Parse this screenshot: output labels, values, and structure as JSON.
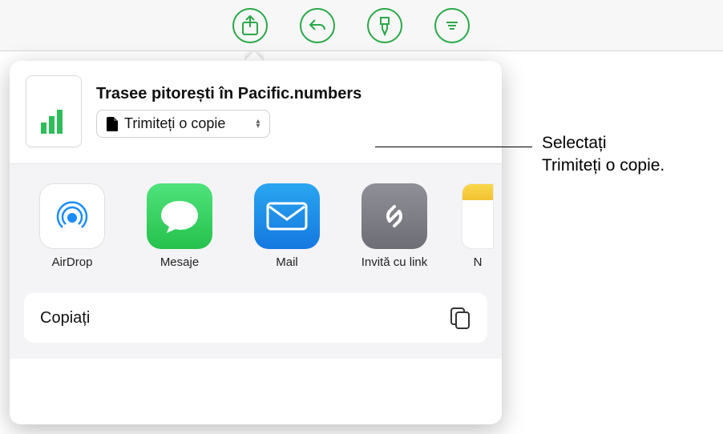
{
  "toolbar": {
    "share": "share-icon",
    "undo": "undo-icon",
    "format": "brush-icon",
    "more": "more-icon"
  },
  "share": {
    "document_title": "Trasee pitorești în Pacific.numbers",
    "mode_label": "Trimiteți o copie",
    "apps": [
      {
        "name": "AirDrop",
        "id": "airdrop"
      },
      {
        "name": "Mesaje",
        "id": "messages"
      },
      {
        "name": "Mail",
        "id": "mail"
      },
      {
        "name": "Invită cu link",
        "id": "invite-link"
      },
      {
        "name": "N",
        "id": "notes"
      }
    ],
    "actions": {
      "copy": "Copiați"
    }
  },
  "callout": {
    "line1": "Selectați",
    "line2": "Trimiteți o copie."
  }
}
